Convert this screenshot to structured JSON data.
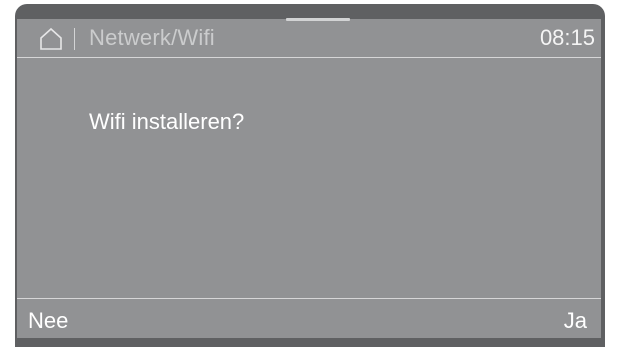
{
  "header": {
    "home_icon": "home-icon",
    "title": "Netwerk/Wifi",
    "time": "08:15"
  },
  "main": {
    "question": "Wifi installeren?"
  },
  "footer": {
    "no_label": "Nee",
    "yes_label": "Ja"
  },
  "colors": {
    "screen_background": "#919294",
    "frame": "#5f6062",
    "text": "#ffffff"
  }
}
